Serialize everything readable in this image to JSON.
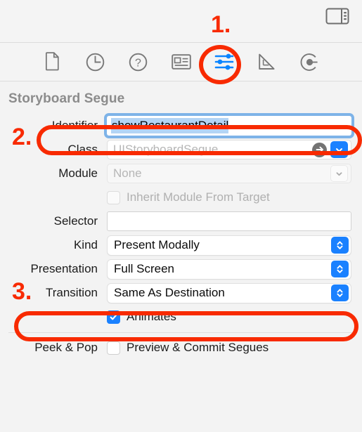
{
  "window": {
    "panel_toggle_icon": "inspector-panel-toggle-icon"
  },
  "tabbar": {
    "tabs": [
      {
        "name": "file-inspector",
        "icon": "document-icon",
        "selected": false
      },
      {
        "name": "history-inspector",
        "icon": "clock-icon",
        "selected": false
      },
      {
        "name": "quick-help-inspector",
        "icon": "question-circle-icon",
        "selected": false
      },
      {
        "name": "identity-inspector",
        "icon": "id-card-icon",
        "selected": false
      },
      {
        "name": "attributes-inspector",
        "icon": "sliders-icon",
        "selected": true
      },
      {
        "name": "size-inspector",
        "icon": "ruler-triangle-icon",
        "selected": false
      },
      {
        "name": "connections-inspector",
        "icon": "connection-dot-icon",
        "selected": false
      }
    ]
  },
  "inspector": {
    "section_title": "Storyboard Segue",
    "rows": {
      "identifier": {
        "label": "Identifier",
        "value": "showRestaurantDetail",
        "placeholder": "Identifier",
        "selected": true,
        "focused": true
      },
      "class": {
        "label": "Class",
        "value": "",
        "placeholder": "UIStoryboardSegue",
        "jump_icon": "arrow-right-circle-icon",
        "dropdown_icon": "chevron-down-icon"
      },
      "module": {
        "label": "Module",
        "value": "",
        "placeholder": "None",
        "dropdown_icon": "chevron-down-icon",
        "disabled": true
      },
      "inherit_module": {
        "label": "Inherit Module From Target",
        "checked": false,
        "disabled": true
      },
      "selector": {
        "label": "Selector",
        "value": "",
        "placeholder": ""
      },
      "kind": {
        "label": "Kind",
        "value": "Present Modally",
        "stepper_icon": "chevron-up-down-icon"
      },
      "presentation": {
        "label": "Presentation",
        "value": "Full Screen",
        "stepper_icon": "chevron-up-down-icon"
      },
      "transition": {
        "label": "Transition",
        "value": "Same As Destination",
        "stepper_icon": "chevron-up-down-icon"
      },
      "animates": {
        "label": "Animates",
        "checked": true
      },
      "peek_and_pop": {
        "label": "Peek & Pop",
        "checkbox_label": "Preview & Commit Segues",
        "checked": false
      }
    }
  },
  "annotations": {
    "color": "#f82a00",
    "step1": "1.",
    "step2": "2.",
    "step3": "3."
  }
}
